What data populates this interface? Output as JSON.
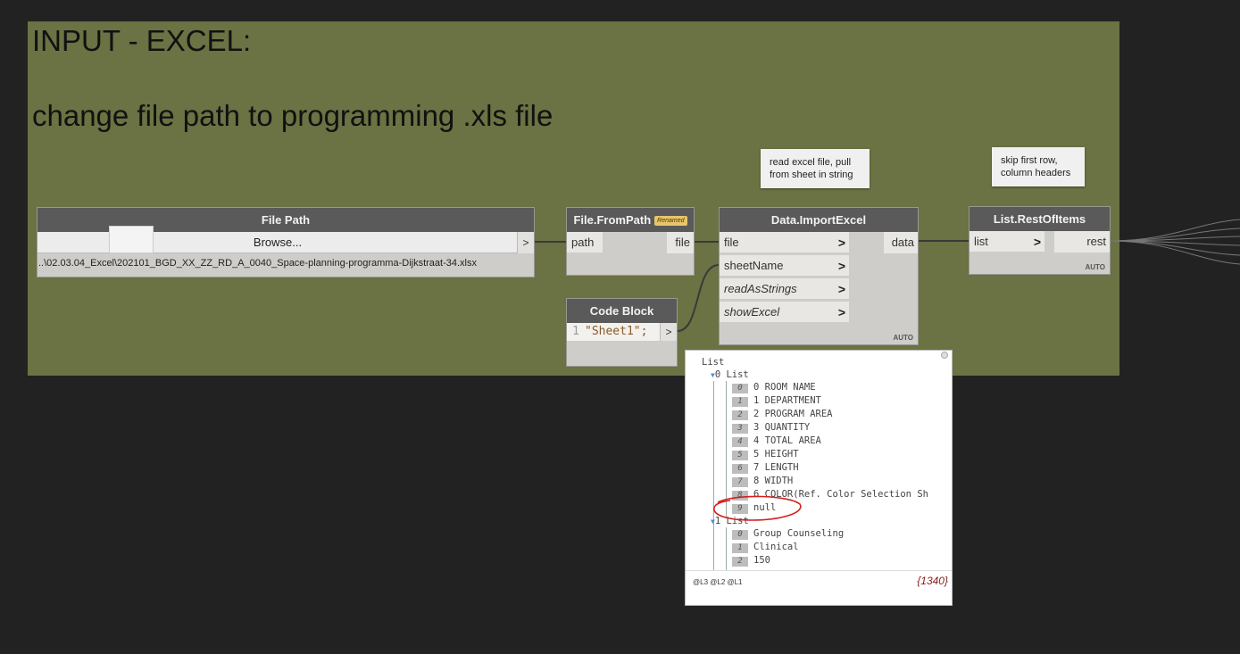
{
  "group": {
    "title": "INPUT - EXCEL:",
    "subtitle": "change file path to programming .xls file"
  },
  "notes": {
    "read_excel": "read excel file, pull from sheet in string",
    "skip_row": "skip first row, column headers"
  },
  "file_path_node": {
    "title": "File Path",
    "browse": "Browse...",
    "out_arrow": ">",
    "path_value": "..\\02.03.04_Excel\\202101_BGD_XX_ZZ_RD_A_0040_Space-planning-programma-Dijkstraat-34.xlsx"
  },
  "from_path_node": {
    "title": "File.FromPath",
    "badge": "Renamed",
    "input": "path",
    "output": "file"
  },
  "code_block_node": {
    "title": "Code Block",
    "line_no": "1",
    "code": "\"Sheet1\";",
    "out_arrow": ">"
  },
  "import_excel_node": {
    "title": "Data.ImportExcel",
    "inputs": [
      "file",
      "sheetName",
      "readAsStrings",
      "showExcel"
    ],
    "output": "data",
    "chevron": ">",
    "lacing": "AUTO"
  },
  "rest_items_node": {
    "title": "List.RestOfItems",
    "input": "list",
    "output": "rest",
    "chevron": ">",
    "lacing": "AUTO"
  },
  "preview": {
    "root": "List",
    "list0_header": "0 List",
    "list0_index": "0",
    "list0_items": [
      {
        "i": "0",
        "v": "0 ROOM NAME"
      },
      {
        "i": "1",
        "v": "1 DEPARTMENT"
      },
      {
        "i": "2",
        "v": "2 PROGRAM AREA"
      },
      {
        "i": "3",
        "v": "3 QUANTITY"
      },
      {
        "i": "4",
        "v": "4 TOTAL AREA"
      },
      {
        "i": "5",
        "v": "5 HEIGHT"
      },
      {
        "i": "6",
        "v": "7 LENGTH"
      },
      {
        "i": "7",
        "v": "8 WIDTH"
      },
      {
        "i": "8",
        "v": "6 COLOR(Ref. Color Selection Sh"
      },
      {
        "i": "9",
        "v": "null"
      }
    ],
    "list1_header": "1 List",
    "list1_items": [
      {
        "i": "0",
        "v": "Group Counseling"
      },
      {
        "i": "1",
        "v": "Clinical"
      },
      {
        "i": "2",
        "v": "150"
      }
    ],
    "levels": "@L3 @L2 @L1",
    "count": "{1340}"
  },
  "colors": {
    "background": "#222222",
    "group": "#6b7243",
    "node_header": "#5a5a5a",
    "annotation_circle": "#d42020"
  }
}
